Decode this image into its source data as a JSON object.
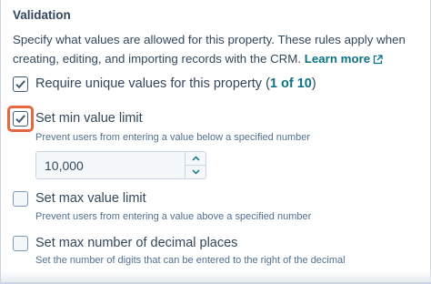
{
  "section": {
    "title": "Validation",
    "description": "Specify what values are allowed for this property. These rules apply when creating, editing, and importing records with the CRM.",
    "learn_more": "Learn more"
  },
  "options": [
    {
      "label": "Require unique values for this property",
      "count": "1 of 10",
      "checked": true
    },
    {
      "label": "Set min value limit",
      "help": "Prevent users from entering a value below a specified number",
      "checked": true,
      "input_value": "10,000"
    },
    {
      "label": "Set max value limit",
      "help": "Prevent users from entering a value above a specified number",
      "checked": false
    },
    {
      "label": "Set max number of decimal places",
      "help": "Set the number of digits that can be entered to the right of the decimal",
      "checked": false
    }
  ],
  "icons": {
    "checkmark": "check-icon",
    "external_link": "external-link-icon",
    "stepper_up": "chevron-up-icon",
    "stepper_down": "chevron-down-icon"
  },
  "colors": {
    "text": "#33475b",
    "link": "#0b7285",
    "highlight": "#e8663d"
  }
}
